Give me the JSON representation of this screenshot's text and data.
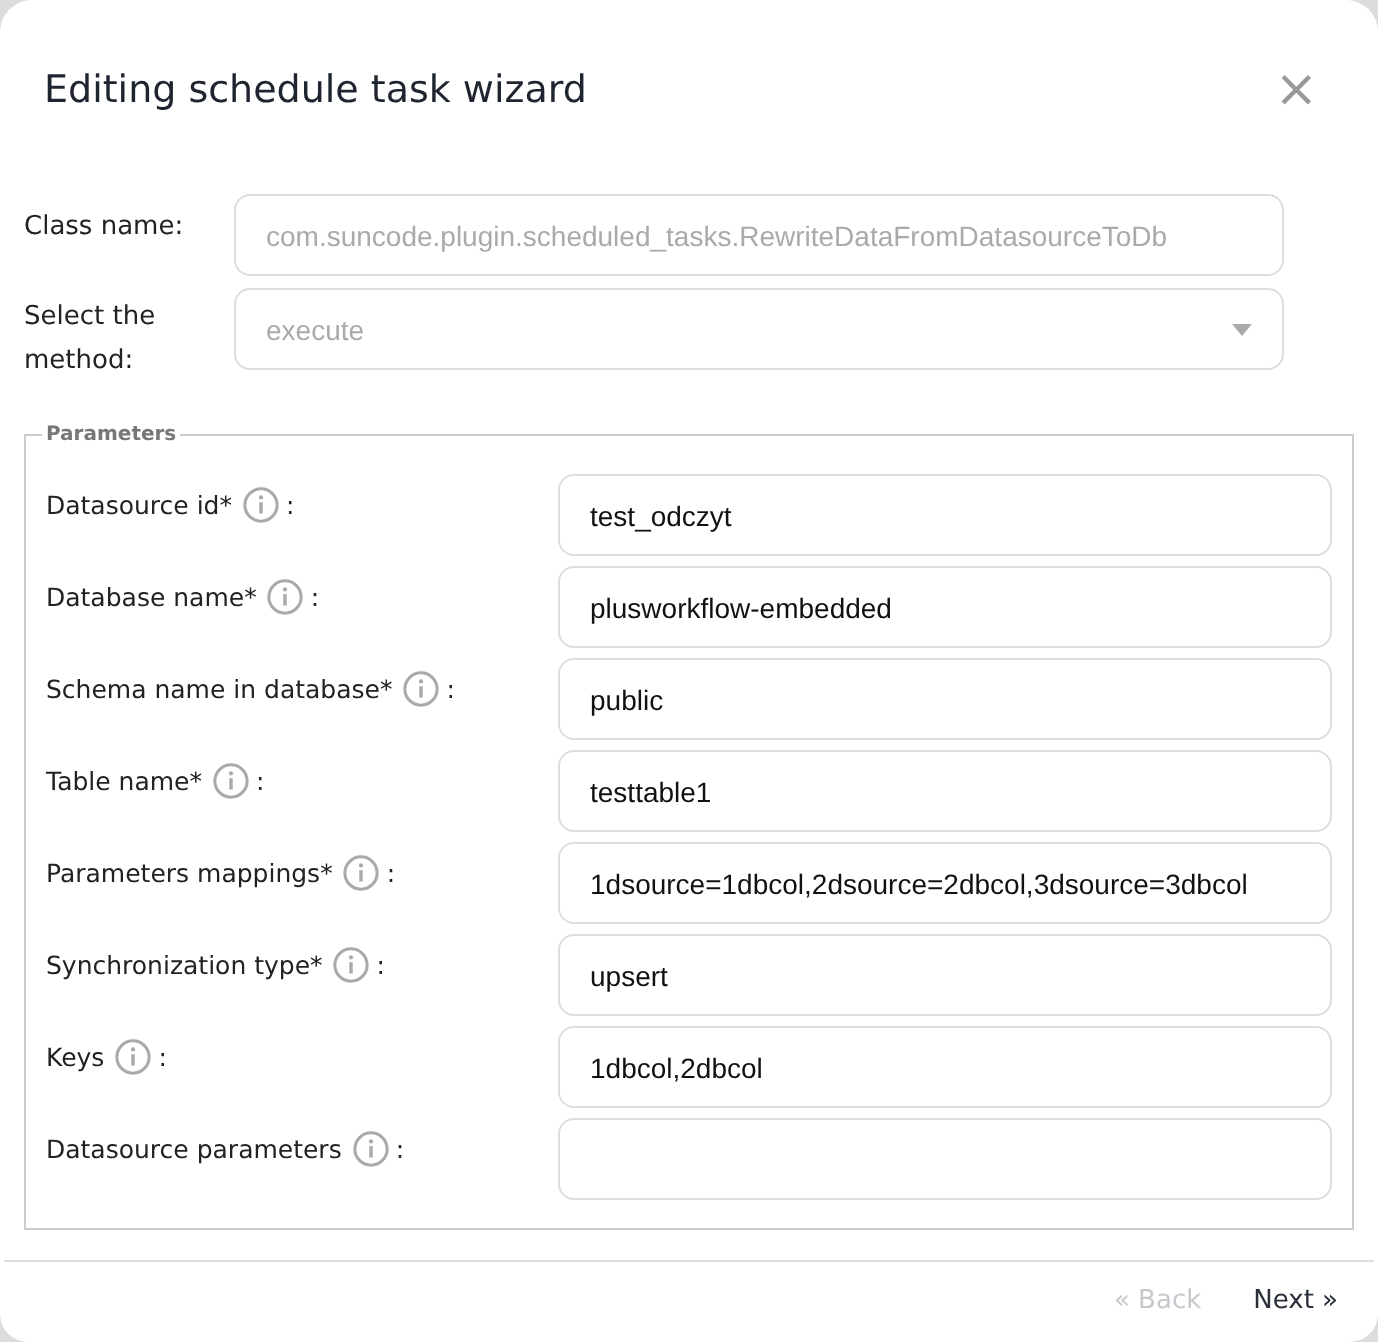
{
  "dialog": {
    "title": "Editing schedule task wizard",
    "close": "×"
  },
  "class_name": {
    "label": "Class name:",
    "value": "com.suncode.plugin.scheduled_tasks.RewriteDataFromDatasourceToDb",
    "disabled": true
  },
  "method": {
    "label": "Select the method:",
    "value": "execute",
    "disabled": true
  },
  "parameters": {
    "legend": "Parameters",
    "fields": [
      {
        "label": "Datasource id*",
        "value": "test_odczyt"
      },
      {
        "label": "Database name*",
        "value": "plusworkflow-embedded"
      },
      {
        "label": "Schema name in database*",
        "value": "public"
      },
      {
        "label": "Table name*",
        "value": "testtable1"
      },
      {
        "label": "Parameters mappings*",
        "value": "1dsource=1dbcol,2dsource=2dbcol,3dsource=3dbcol"
      },
      {
        "label": "Synchronization type*",
        "value": "upsert"
      },
      {
        "label": "Keys",
        "value": "1dbcol,2dbcol"
      },
      {
        "label": "Datasource parameters"
      }
    ],
    "separator": ":"
  },
  "footer": {
    "buttons": [
      {
        "label": "« Back",
        "disabled": true
      },
      {
        "label": "Next »",
        "disabled": false
      }
    ]
  }
}
